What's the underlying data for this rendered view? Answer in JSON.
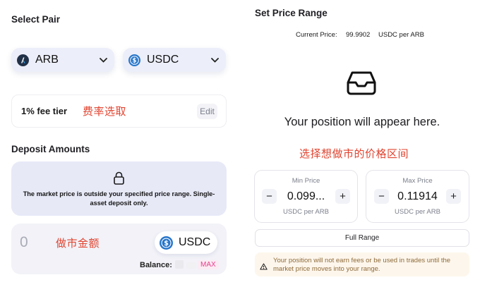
{
  "select_pair": {
    "title": "Select Pair",
    "token_a": {
      "symbol": "ARB",
      "icon": "arbitrum-coin-icon",
      "color": "#213147"
    },
    "token_b": {
      "symbol": "USDC",
      "icon": "usdc-coin-icon",
      "color": "#2775ca"
    }
  },
  "fee_tier": {
    "label": "1% fee tier",
    "annotation": "费率选取",
    "edit_label": "Edit"
  },
  "deposit": {
    "title": "Deposit Amounts",
    "lock_icon": "lock-icon",
    "warning": "The market price is outside your specified price range. Single-asset deposit only.",
    "amount": "0",
    "annotation": "做市金额",
    "token": "USDC",
    "balance_label": "Balance:",
    "max_label": "MAX"
  },
  "price_range": {
    "title": "Set Price Range",
    "current_price_label": "Current Price:",
    "current_price_value": "99.9902",
    "current_price_unit": "USDC per ARB",
    "empty_message": "Your position will appear here.",
    "annotation": "选择想做市的价格区间",
    "min": {
      "label": "Min Price",
      "value": "0.099...",
      "unit": "USDC per ARB"
    },
    "max": {
      "label": "Max Price",
      "value": "0.11914",
      "unit": "USDC per ARB"
    },
    "decrement": "−",
    "increment": "+",
    "full_range_label": "Full Range",
    "alert": "Your position will not earn fees or be used in trades until the market price moves into your range."
  },
  "colors": {
    "accent_panel": "#e7e9f7",
    "annotation_red": "#e0432f",
    "max_pink": "#e83e8c",
    "alert_bg": "#fdf6ec"
  }
}
